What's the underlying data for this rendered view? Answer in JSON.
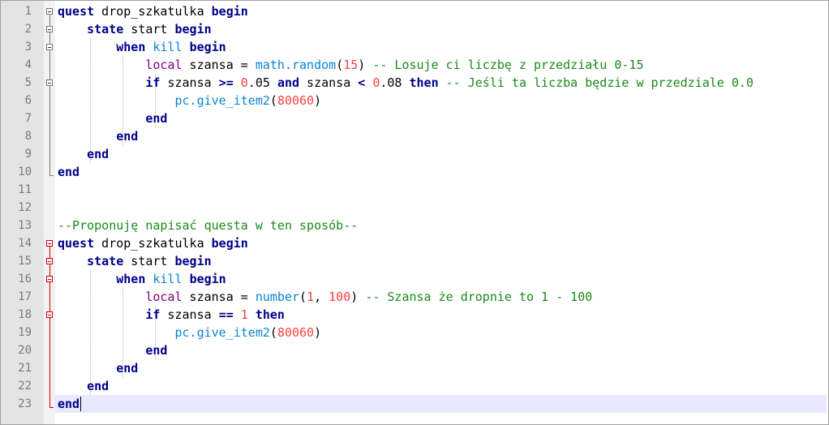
{
  "editor": {
    "current_line": 23,
    "lines": [
      {
        "n": "1",
        "tokens": [
          {
            "t": "quest",
            "c": "kw"
          },
          {
            "t": " drop_szkatulka ",
            "c": "plain"
          },
          {
            "t": "begin",
            "c": "kw"
          }
        ]
      },
      {
        "n": "2",
        "tokens": [
          {
            "t": "    ",
            "c": "plain"
          },
          {
            "t": "state",
            "c": "kw"
          },
          {
            "t": " start ",
            "c": "plain"
          },
          {
            "t": "begin",
            "c": "kw"
          }
        ]
      },
      {
        "n": "3",
        "tokens": [
          {
            "t": "        ",
            "c": "plain"
          },
          {
            "t": "when",
            "c": "kw"
          },
          {
            "t": " ",
            "c": "plain"
          },
          {
            "t": "kill",
            "c": "fn"
          },
          {
            "t": " ",
            "c": "plain"
          },
          {
            "t": "begin",
            "c": "kw"
          }
        ]
      },
      {
        "n": "4",
        "tokens": [
          {
            "t": "            ",
            "c": "plain"
          },
          {
            "t": "local",
            "c": "loc"
          },
          {
            "t": " szansa = ",
            "c": "plain"
          },
          {
            "t": "math.random",
            "c": "fn"
          },
          {
            "t": "(",
            "c": "plain"
          },
          {
            "t": "15",
            "c": "num"
          },
          {
            "t": ") ",
            "c": "plain"
          },
          {
            "t": "-- Losuje ci liczbę z przedziału 0-15",
            "c": "cm"
          }
        ]
      },
      {
        "n": "5",
        "tokens": [
          {
            "t": "            ",
            "c": "plain"
          },
          {
            "t": "if",
            "c": "kw"
          },
          {
            "t": " szansa ",
            "c": "plain"
          },
          {
            "t": ">=",
            "c": "op"
          },
          {
            "t": " ",
            "c": "plain"
          },
          {
            "t": "0",
            "c": "num"
          },
          {
            "t": ".05 ",
            "c": "plain"
          },
          {
            "t": "and",
            "c": "kw"
          },
          {
            "t": " szansa ",
            "c": "plain"
          },
          {
            "t": "<",
            "c": "op"
          },
          {
            "t": " ",
            "c": "plain"
          },
          {
            "t": "0",
            "c": "num"
          },
          {
            "t": ".08 ",
            "c": "plain"
          },
          {
            "t": "then",
            "c": "kw"
          },
          {
            "t": " ",
            "c": "plain"
          },
          {
            "t": "-- Jeśli ta liczba będzie w przedziale 0.0",
            "c": "cm"
          }
        ]
      },
      {
        "n": "6",
        "tokens": [
          {
            "t": "                ",
            "c": "plain"
          },
          {
            "t": "pc.give_item2",
            "c": "fn"
          },
          {
            "t": "(",
            "c": "plain"
          },
          {
            "t": "80060",
            "c": "num"
          },
          {
            "t": ")",
            "c": "plain"
          }
        ]
      },
      {
        "n": "7",
        "tokens": [
          {
            "t": "            ",
            "c": "plain"
          },
          {
            "t": "end",
            "c": "kw"
          }
        ]
      },
      {
        "n": "8",
        "tokens": [
          {
            "t": "        ",
            "c": "plain"
          },
          {
            "t": "end",
            "c": "kw"
          }
        ]
      },
      {
        "n": "9",
        "tokens": [
          {
            "t": "    ",
            "c": "plain"
          },
          {
            "t": "end",
            "c": "kw"
          }
        ]
      },
      {
        "n": "10",
        "tokens": [
          {
            "t": "end",
            "c": "kw"
          }
        ]
      },
      {
        "n": "11",
        "tokens": []
      },
      {
        "n": "12",
        "tokens": []
      },
      {
        "n": "13",
        "tokens": [
          {
            "t": "--Proponuję napisać questa w ten sposób--",
            "c": "cm"
          }
        ]
      },
      {
        "n": "14",
        "tokens": [
          {
            "t": "quest",
            "c": "kw"
          },
          {
            "t": " drop_szkatulka ",
            "c": "plain"
          },
          {
            "t": "begin",
            "c": "kw"
          }
        ]
      },
      {
        "n": "15",
        "tokens": [
          {
            "t": "    ",
            "c": "plain"
          },
          {
            "t": "state",
            "c": "kw"
          },
          {
            "t": " start ",
            "c": "plain"
          },
          {
            "t": "begin",
            "c": "kw"
          }
        ]
      },
      {
        "n": "16",
        "tokens": [
          {
            "t": "        ",
            "c": "plain"
          },
          {
            "t": "when",
            "c": "kw"
          },
          {
            "t": " ",
            "c": "plain"
          },
          {
            "t": "kill",
            "c": "fn"
          },
          {
            "t": " ",
            "c": "plain"
          },
          {
            "t": "begin",
            "c": "kw"
          }
        ]
      },
      {
        "n": "17",
        "tokens": [
          {
            "t": "            ",
            "c": "plain"
          },
          {
            "t": "local",
            "c": "loc"
          },
          {
            "t": " szansa = ",
            "c": "plain"
          },
          {
            "t": "number",
            "c": "fn"
          },
          {
            "t": "(",
            "c": "plain"
          },
          {
            "t": "1",
            "c": "num"
          },
          {
            "t": ", ",
            "c": "plain"
          },
          {
            "t": "100",
            "c": "num"
          },
          {
            "t": ") ",
            "c": "plain"
          },
          {
            "t": "-- Szansa że dropnie to 1 - 100",
            "c": "cm"
          }
        ]
      },
      {
        "n": "18",
        "tokens": [
          {
            "t": "            ",
            "c": "plain"
          },
          {
            "t": "if",
            "c": "kw"
          },
          {
            "t": " szansa ",
            "c": "plain"
          },
          {
            "t": "==",
            "c": "op"
          },
          {
            "t": " ",
            "c": "plain"
          },
          {
            "t": "1",
            "c": "num"
          },
          {
            "t": " ",
            "c": "plain"
          },
          {
            "t": "then",
            "c": "kw"
          }
        ]
      },
      {
        "n": "19",
        "tokens": [
          {
            "t": "                ",
            "c": "plain"
          },
          {
            "t": "pc.give_item2",
            "c": "fn"
          },
          {
            "t": "(",
            "c": "plain"
          },
          {
            "t": "80060",
            "c": "num"
          },
          {
            "t": ")",
            "c": "plain"
          }
        ]
      },
      {
        "n": "20",
        "tokens": [
          {
            "t": "            ",
            "c": "plain"
          },
          {
            "t": "end",
            "c": "kw"
          }
        ]
      },
      {
        "n": "21",
        "tokens": [
          {
            "t": "        ",
            "c": "plain"
          },
          {
            "t": "end",
            "c": "kw"
          }
        ]
      },
      {
        "n": "22",
        "tokens": [
          {
            "t": "    ",
            "c": "plain"
          },
          {
            "t": "end",
            "c": "kw"
          }
        ]
      },
      {
        "n": "23",
        "tokens": [
          {
            "t": "end",
            "c": "kw"
          }
        ]
      }
    ],
    "fold_markers": {
      "open": [
        1,
        2,
        3,
        5,
        14,
        15,
        16,
        18
      ],
      "highlighted_block": [
        14,
        23
      ],
      "icon": "fold-collapse-icon"
    },
    "colors": {
      "keyword": "#00008b",
      "function": "#0a84d4",
      "local": "#800080",
      "number": "#ff4040",
      "comment": "#1a8a1a",
      "current_line": "#e8e8ff",
      "fold_highlight": "#d00000"
    }
  }
}
